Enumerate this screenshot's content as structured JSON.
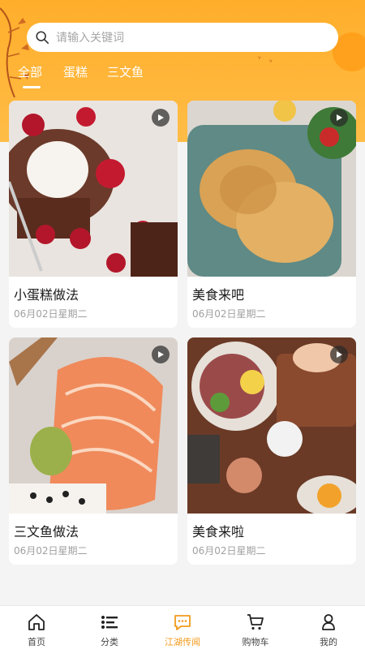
{
  "search": {
    "placeholder": "请输入关键词"
  },
  "tabs": [
    {
      "label": "全部",
      "active": true
    },
    {
      "label": "蛋糕",
      "active": false
    },
    {
      "label": "三文鱼",
      "active": false
    }
  ],
  "cards": [
    {
      "title": "小蛋糕做法",
      "date": "06月02日星期二"
    },
    {
      "title": "美食来吧",
      "date": "06月02日星期二"
    },
    {
      "title": "三文鱼做法",
      "date": "06月02日星期二"
    },
    {
      "title": "美食来啦",
      "date": "06月02日星期二"
    }
  ],
  "nav": [
    {
      "label": "首页",
      "icon": "home-icon"
    },
    {
      "label": "分类",
      "icon": "list-icon"
    },
    {
      "label": "江湖传闻",
      "icon": "chat-icon",
      "active": true
    },
    {
      "label": "购物车",
      "icon": "cart-icon"
    },
    {
      "label": "我的",
      "icon": "user-icon"
    }
  ],
  "colors": {
    "accent": "#f29a1c",
    "header": "#ffb63a"
  }
}
